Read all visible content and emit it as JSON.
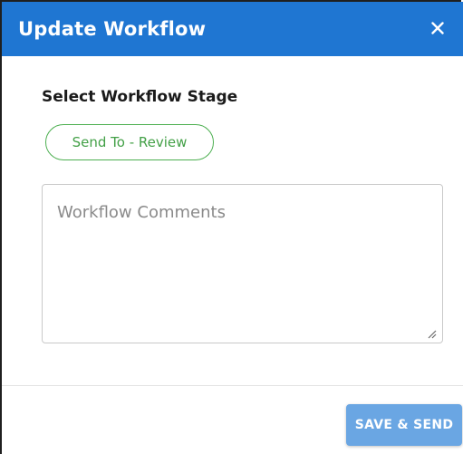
{
  "dialog": {
    "title": "Update Workflow",
    "close_icon": "close-icon"
  },
  "stage": {
    "label": "Select Workflow Stage",
    "selected_option": "Send To - Review"
  },
  "comments": {
    "placeholder": "Workflow Comments",
    "value": ""
  },
  "footer": {
    "save_label": "SAVE & SEND"
  },
  "colors": {
    "header_bg": "#1f76d2",
    "chip_accent": "#4caf50",
    "button_bg": "#6aa6e3"
  }
}
